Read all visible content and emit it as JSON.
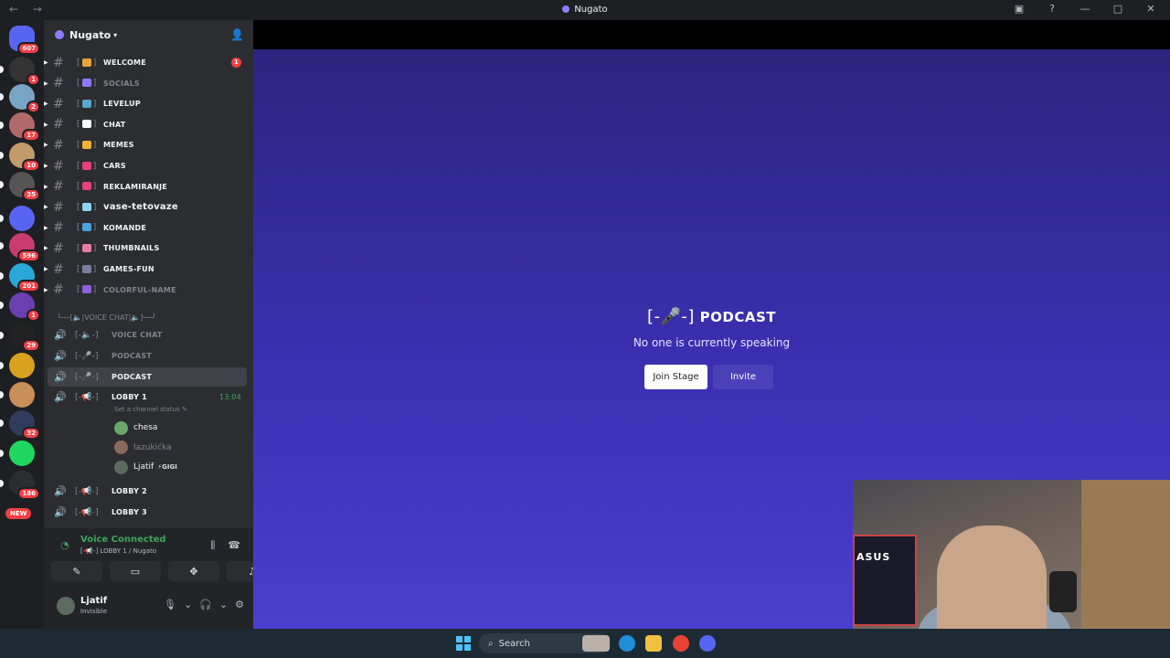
{
  "titlebar": {
    "title": "Nugato",
    "nav": "← →"
  },
  "guilds": [
    {
      "badge": "607",
      "color": "#5865f2"
    },
    {
      "badge": "1",
      "color": "#333"
    },
    {
      "badge": "2",
      "color": "#7aa5c4"
    },
    {
      "badge": "17",
      "color": "#b06a6a"
    },
    {
      "badge": "10",
      "color": "#c29b6a"
    },
    {
      "badge": "35",
      "color": "#555"
    },
    {
      "badge": "",
      "color": "#5865f2"
    },
    {
      "badge": "596",
      "color": "#c93c6d"
    },
    {
      "badge": "201",
      "color": "#2aa7d9"
    },
    {
      "badge": "1",
      "color": "#6b3fb0"
    },
    {
      "badge": "29",
      "color": "#222"
    },
    {
      "badge": "",
      "color": "#d9a21e"
    },
    {
      "badge": "",
      "color": "#c98f5a"
    },
    {
      "badge": "32",
      "color": "#2f3b5c"
    },
    {
      "badge": "",
      "color": "#1ed760"
    },
    {
      "badge": "186",
      "color": "#2b2d31"
    }
  ],
  "new_badge": "NEW",
  "server": {
    "name": "Nugato"
  },
  "channels": [
    {
      "name": "WELCOME",
      "emo": "✨",
      "color": "#e8a33b",
      "unread": "1",
      "muted": false
    },
    {
      "name": "SOCIALS",
      "emo": "▤",
      "color": "#8e7cff",
      "unread": "",
      "muted": true
    },
    {
      "name": "LEVELUP",
      "emo": "▨",
      "color": "#58a6c9",
      "unread": "",
      "muted": false
    },
    {
      "name": "CHAT",
      "emo": "●",
      "color": "#ffffff",
      "unread": "",
      "muted": false
    },
    {
      "name": "MEMES",
      "emo": "☻",
      "color": "#f0b232",
      "unread": "",
      "muted": false
    },
    {
      "name": "CARS",
      "emo": "▬",
      "color": "#e8417a",
      "unread": "",
      "muted": false
    },
    {
      "name": "REKLAMIRANJE",
      "emo": "▣",
      "color": "#e8417a",
      "unread": "",
      "muted": false
    },
    {
      "name": "vase-tetovaze",
      "emo": "▭",
      "color": "#8fd3f4",
      "unread": "",
      "muted": false
    },
    {
      "name": "KOMANDE",
      "emo": "▬",
      "color": "#4aa3df",
      "unread": "",
      "muted": false
    },
    {
      "name": "THUMBNAILS",
      "emo": "❀",
      "color": "#e87aa0",
      "unread": "",
      "muted": false
    },
    {
      "name": "GAMES-FUN",
      "emo": "◉",
      "color": "#7a7fa0",
      "unread": "",
      "muted": false
    },
    {
      "name": "COLORFUL-NAME",
      "emo": "●",
      "color": "#8e5fd9",
      "unread": "",
      "muted": true
    }
  ],
  "category": "└──[🔈|VOICE CHAT|🔈]──┘",
  "voice_channels": [
    {
      "prefix": "[-🔈-]",
      "name": "VOICE CHAT",
      "muted": true
    },
    {
      "prefix": "[-🎤-]",
      "name": "PODCAST",
      "muted": true
    },
    {
      "prefix": "[-🎤-]",
      "name": "PODCAST",
      "muted": false,
      "selected": true
    },
    {
      "prefix": "[-📢-]",
      "name": "LOBBY 1",
      "muted": false,
      "timer": "13:04"
    }
  ],
  "channel_status": "Set a channel status ✎",
  "members": [
    {
      "name": "chesa",
      "tag": "",
      "color": "#6aa86a",
      "dim": false
    },
    {
      "name": "lazukićka",
      "tag": "",
      "color": "#8a6a5a",
      "dim": true
    },
    {
      "name": "Ljatif",
      "tag": "⚡GIGI",
      "color": "#5c6b5f",
      "dim": false
    }
  ],
  "voice_channels_2": [
    {
      "prefix": "[-📢-]",
      "name": "LOBBY 2"
    },
    {
      "prefix": "[-📢-]",
      "name": "LOBBY 3"
    }
  ],
  "voice_panel": {
    "status": "Voice Connected",
    "sub": "[-📢-] LOBBY 1 / Nugato"
  },
  "user": {
    "name": "Ljatif",
    "status": "Invisible"
  },
  "stage": {
    "prefix": "[-🎤-]",
    "title": "PODCAST",
    "subtitle": "No one is currently speaking",
    "join_label": "Join Stage",
    "invite_label": "Invite"
  },
  "webcam_text": "ASUS",
  "taskbar": {
    "search_label": "Search"
  }
}
